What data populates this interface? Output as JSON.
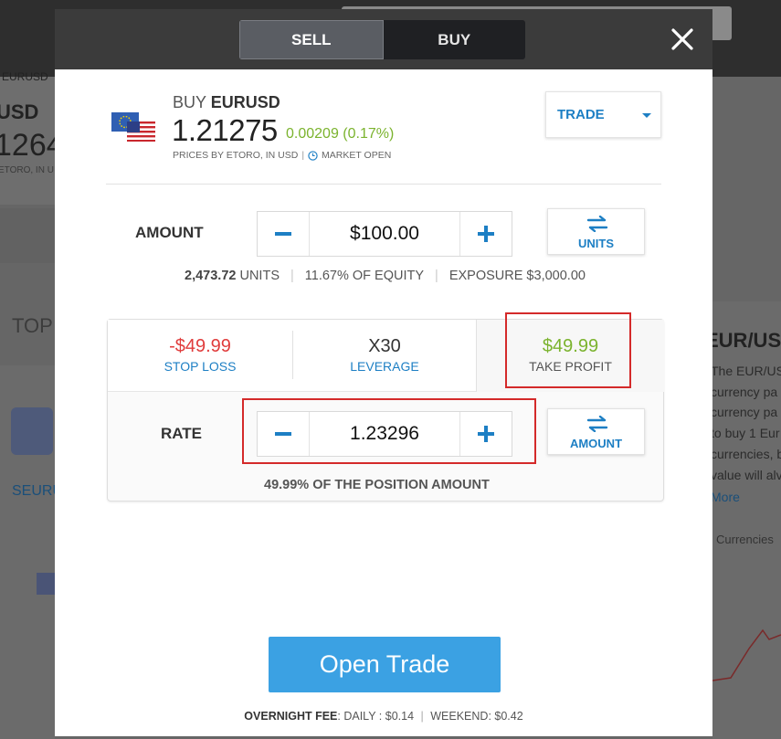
{
  "background": {
    "ticker_partial": "EURUSD",
    "symbol_partial": "USD",
    "price_partial": "1264",
    "source_partial": "ETORO, IN U",
    "section_partial": "TOP",
    "link_partial": "SEURU",
    "right_title_partial": "EUR/US",
    "right_text_lines": [
      "The EUR/US",
      "currency pa",
      "currency pa",
      "to buy 1 Eur",
      "currencies, b",
      "value will alv"
    ],
    "right_more": "More",
    "right_tag": "Currencies"
  },
  "toggle": {
    "sell_label": "SELL",
    "buy_label": "BUY"
  },
  "close_icon": "close-icon",
  "instrument": {
    "action": "BUY",
    "symbol": "EURUSD",
    "price": "1.21275",
    "change": "0.00209 (0.17%)",
    "prices_by": "PRICES BY ETORO, IN USD",
    "market_status": "MARKET OPEN",
    "flag_icon": "eu-us-flag-icon"
  },
  "order_type": {
    "label": "TRADE"
  },
  "amount": {
    "label": "AMOUNT",
    "value": "$100.00",
    "switch_label": "UNITS",
    "units_value": "2,473.72",
    "units_label": "UNITS",
    "equity": "11.67% OF EQUITY",
    "exposure": "EXPOSURE $3,000.00"
  },
  "settings": {
    "stop_loss": {
      "value": "-$49.99",
      "label": "STOP LOSS"
    },
    "leverage": {
      "value": "X30",
      "label": "LEVERAGE"
    },
    "take_profit": {
      "value": "$49.99",
      "label": "TAKE PROFIT"
    }
  },
  "rate": {
    "label": "RATE",
    "value": "1.23296",
    "switch_label": "AMOUNT",
    "note": "49.99% OF THE POSITION AMOUNT"
  },
  "open_trade": {
    "label": "Open Trade"
  },
  "fee": {
    "title": "OVERNIGHT FEE",
    "daily": "DAILY : $0.14",
    "weekend": "WEEKEND: $0.42"
  },
  "colors": {
    "accent": "#1d7fc4",
    "positive": "#7bb32e",
    "negative": "#e03c3c",
    "primary_button": "#3ba1e3",
    "highlight": "#d42a2a"
  }
}
